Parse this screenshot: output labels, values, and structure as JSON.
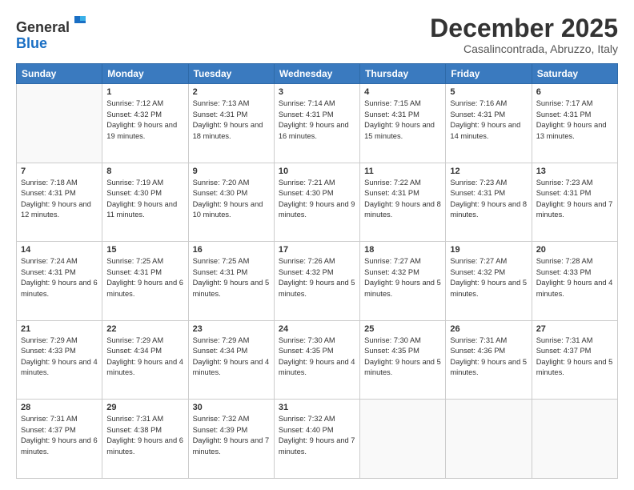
{
  "logo": {
    "general": "General",
    "blue": "Blue"
  },
  "header": {
    "month": "December 2025",
    "location": "Casalincontrada, Abruzzo, Italy"
  },
  "days_of_week": [
    "Sunday",
    "Monday",
    "Tuesday",
    "Wednesday",
    "Thursday",
    "Friday",
    "Saturday"
  ],
  "weeks": [
    [
      {
        "day": "",
        "sunrise": "",
        "sunset": "",
        "daylight": ""
      },
      {
        "day": "1",
        "sunrise": "Sunrise: 7:12 AM",
        "sunset": "Sunset: 4:32 PM",
        "daylight": "Daylight: 9 hours and 19 minutes."
      },
      {
        "day": "2",
        "sunrise": "Sunrise: 7:13 AM",
        "sunset": "Sunset: 4:31 PM",
        "daylight": "Daylight: 9 hours and 18 minutes."
      },
      {
        "day": "3",
        "sunrise": "Sunrise: 7:14 AM",
        "sunset": "Sunset: 4:31 PM",
        "daylight": "Daylight: 9 hours and 16 minutes."
      },
      {
        "day": "4",
        "sunrise": "Sunrise: 7:15 AM",
        "sunset": "Sunset: 4:31 PM",
        "daylight": "Daylight: 9 hours and 15 minutes."
      },
      {
        "day": "5",
        "sunrise": "Sunrise: 7:16 AM",
        "sunset": "Sunset: 4:31 PM",
        "daylight": "Daylight: 9 hours and 14 minutes."
      },
      {
        "day": "6",
        "sunrise": "Sunrise: 7:17 AM",
        "sunset": "Sunset: 4:31 PM",
        "daylight": "Daylight: 9 hours and 13 minutes."
      }
    ],
    [
      {
        "day": "7",
        "sunrise": "Sunrise: 7:18 AM",
        "sunset": "Sunset: 4:31 PM",
        "daylight": "Daylight: 9 hours and 12 minutes."
      },
      {
        "day": "8",
        "sunrise": "Sunrise: 7:19 AM",
        "sunset": "Sunset: 4:30 PM",
        "daylight": "Daylight: 9 hours and 11 minutes."
      },
      {
        "day": "9",
        "sunrise": "Sunrise: 7:20 AM",
        "sunset": "Sunset: 4:30 PM",
        "daylight": "Daylight: 9 hours and 10 minutes."
      },
      {
        "day": "10",
        "sunrise": "Sunrise: 7:21 AM",
        "sunset": "Sunset: 4:30 PM",
        "daylight": "Daylight: 9 hours and 9 minutes."
      },
      {
        "day": "11",
        "sunrise": "Sunrise: 7:22 AM",
        "sunset": "Sunset: 4:31 PM",
        "daylight": "Daylight: 9 hours and 8 minutes."
      },
      {
        "day": "12",
        "sunrise": "Sunrise: 7:23 AM",
        "sunset": "Sunset: 4:31 PM",
        "daylight": "Daylight: 9 hours and 8 minutes."
      },
      {
        "day": "13",
        "sunrise": "Sunrise: 7:23 AM",
        "sunset": "Sunset: 4:31 PM",
        "daylight": "Daylight: 9 hours and 7 minutes."
      }
    ],
    [
      {
        "day": "14",
        "sunrise": "Sunrise: 7:24 AM",
        "sunset": "Sunset: 4:31 PM",
        "daylight": "Daylight: 9 hours and 6 minutes."
      },
      {
        "day": "15",
        "sunrise": "Sunrise: 7:25 AM",
        "sunset": "Sunset: 4:31 PM",
        "daylight": "Daylight: 9 hours and 6 minutes."
      },
      {
        "day": "16",
        "sunrise": "Sunrise: 7:25 AM",
        "sunset": "Sunset: 4:31 PM",
        "daylight": "Daylight: 9 hours and 5 minutes."
      },
      {
        "day": "17",
        "sunrise": "Sunrise: 7:26 AM",
        "sunset": "Sunset: 4:32 PM",
        "daylight": "Daylight: 9 hours and 5 minutes."
      },
      {
        "day": "18",
        "sunrise": "Sunrise: 7:27 AM",
        "sunset": "Sunset: 4:32 PM",
        "daylight": "Daylight: 9 hours and 5 minutes."
      },
      {
        "day": "19",
        "sunrise": "Sunrise: 7:27 AM",
        "sunset": "Sunset: 4:32 PM",
        "daylight": "Daylight: 9 hours and 5 minutes."
      },
      {
        "day": "20",
        "sunrise": "Sunrise: 7:28 AM",
        "sunset": "Sunset: 4:33 PM",
        "daylight": "Daylight: 9 hours and 4 minutes."
      }
    ],
    [
      {
        "day": "21",
        "sunrise": "Sunrise: 7:29 AM",
        "sunset": "Sunset: 4:33 PM",
        "daylight": "Daylight: 9 hours and 4 minutes."
      },
      {
        "day": "22",
        "sunrise": "Sunrise: 7:29 AM",
        "sunset": "Sunset: 4:34 PM",
        "daylight": "Daylight: 9 hours and 4 minutes."
      },
      {
        "day": "23",
        "sunrise": "Sunrise: 7:29 AM",
        "sunset": "Sunset: 4:34 PM",
        "daylight": "Daylight: 9 hours and 4 minutes."
      },
      {
        "day": "24",
        "sunrise": "Sunrise: 7:30 AM",
        "sunset": "Sunset: 4:35 PM",
        "daylight": "Daylight: 9 hours and 4 minutes."
      },
      {
        "day": "25",
        "sunrise": "Sunrise: 7:30 AM",
        "sunset": "Sunset: 4:35 PM",
        "daylight": "Daylight: 9 hours and 5 minutes."
      },
      {
        "day": "26",
        "sunrise": "Sunrise: 7:31 AM",
        "sunset": "Sunset: 4:36 PM",
        "daylight": "Daylight: 9 hours and 5 minutes."
      },
      {
        "day": "27",
        "sunrise": "Sunrise: 7:31 AM",
        "sunset": "Sunset: 4:37 PM",
        "daylight": "Daylight: 9 hours and 5 minutes."
      }
    ],
    [
      {
        "day": "28",
        "sunrise": "Sunrise: 7:31 AM",
        "sunset": "Sunset: 4:37 PM",
        "daylight": "Daylight: 9 hours and 6 minutes."
      },
      {
        "day": "29",
        "sunrise": "Sunrise: 7:31 AM",
        "sunset": "Sunset: 4:38 PM",
        "daylight": "Daylight: 9 hours and 6 minutes."
      },
      {
        "day": "30",
        "sunrise": "Sunrise: 7:32 AM",
        "sunset": "Sunset: 4:39 PM",
        "daylight": "Daylight: 9 hours and 7 minutes."
      },
      {
        "day": "31",
        "sunrise": "Sunrise: 7:32 AM",
        "sunset": "Sunset: 4:40 PM",
        "daylight": "Daylight: 9 hours and 7 minutes."
      },
      {
        "day": "",
        "sunrise": "",
        "sunset": "",
        "daylight": ""
      },
      {
        "day": "",
        "sunrise": "",
        "sunset": "",
        "daylight": ""
      },
      {
        "day": "",
        "sunrise": "",
        "sunset": "",
        "daylight": ""
      }
    ]
  ]
}
